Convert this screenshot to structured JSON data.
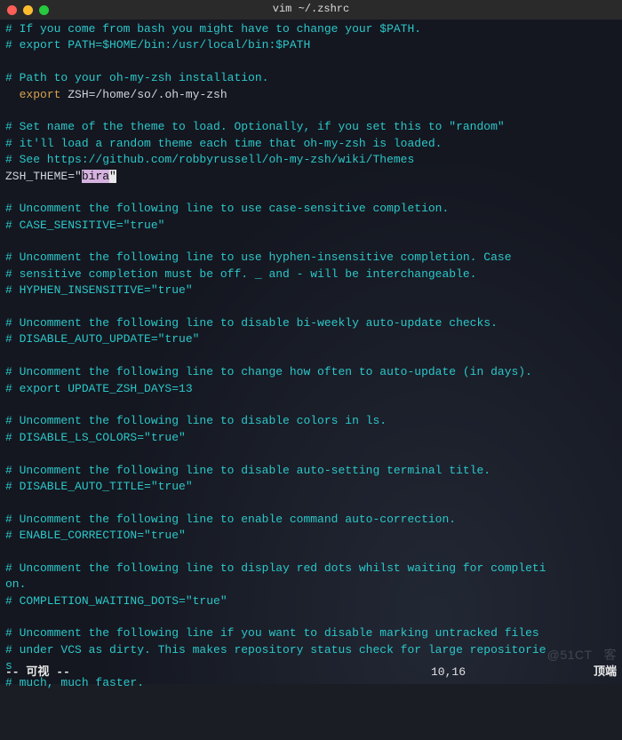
{
  "window": {
    "title": "vim ~/.zshrc"
  },
  "lines": [
    {
      "segments": [
        {
          "cls": "comment",
          "t": "# If you come from bash you might have to change your $PATH."
        }
      ]
    },
    {
      "segments": [
        {
          "cls": "comment",
          "t": "# export PATH=$HOME/bin:/usr/local/bin:$PATH"
        }
      ]
    },
    {
      "segments": []
    },
    {
      "segments": [
        {
          "cls": "comment",
          "t": "# Path to your oh-my-zsh installation."
        }
      ]
    },
    {
      "segments": [
        {
          "cls": "plain",
          "t": "  "
        },
        {
          "cls": "key",
          "t": "export"
        },
        {
          "cls": "plain",
          "t": " ZSH=/home/so/.oh-my-zsh"
        }
      ]
    },
    {
      "segments": []
    },
    {
      "segments": [
        {
          "cls": "comment",
          "t": "# Set name of the theme to load. Optionally, if you set this to \"random\""
        }
      ]
    },
    {
      "segments": [
        {
          "cls": "comment",
          "t": "# it'll load a random theme each time that oh-my-zsh is loaded."
        }
      ]
    },
    {
      "segments": [
        {
          "cls": "comment",
          "t": "# See https://github.com/robbyrussell/oh-my-zsh/wiki/Themes"
        }
      ]
    },
    {
      "segments": [
        {
          "cls": "plain",
          "t": "ZSH_THEME="
        },
        {
          "cls": "str",
          "t": "\""
        },
        {
          "cls": "hl-sel",
          "t": "bira"
        },
        {
          "cls": "hl-cur",
          "t": "\""
        }
      ]
    },
    {
      "segments": []
    },
    {
      "segments": [
        {
          "cls": "comment",
          "t": "# Uncomment the following line to use case-sensitive completion."
        }
      ]
    },
    {
      "segments": [
        {
          "cls": "comment",
          "t": "# CASE_SENSITIVE=\"true\""
        }
      ]
    },
    {
      "segments": []
    },
    {
      "segments": [
        {
          "cls": "comment",
          "t": "# Uncomment the following line to use hyphen-insensitive completion. Case"
        }
      ]
    },
    {
      "segments": [
        {
          "cls": "comment",
          "t": "# sensitive completion must be off. _ and - will be interchangeable."
        }
      ]
    },
    {
      "segments": [
        {
          "cls": "comment",
          "t": "# HYPHEN_INSENSITIVE=\"true\""
        }
      ]
    },
    {
      "segments": []
    },
    {
      "segments": [
        {
          "cls": "comment",
          "t": "# Uncomment the following line to disable bi-weekly auto-update checks."
        }
      ]
    },
    {
      "segments": [
        {
          "cls": "comment",
          "t": "# DISABLE_AUTO_UPDATE=\"true\""
        }
      ]
    },
    {
      "segments": []
    },
    {
      "segments": [
        {
          "cls": "comment",
          "t": "# Uncomment the following line to change how often to auto-update (in days)."
        }
      ]
    },
    {
      "segments": [
        {
          "cls": "comment",
          "t": "# export UPDATE_ZSH_DAYS=13"
        }
      ]
    },
    {
      "segments": []
    },
    {
      "segments": [
        {
          "cls": "comment",
          "t": "# Uncomment the following line to disable colors in ls."
        }
      ]
    },
    {
      "segments": [
        {
          "cls": "comment",
          "t": "# DISABLE_LS_COLORS=\"true\""
        }
      ]
    },
    {
      "segments": []
    },
    {
      "segments": [
        {
          "cls": "comment",
          "t": "# Uncomment the following line to disable auto-setting terminal title."
        }
      ]
    },
    {
      "segments": [
        {
          "cls": "comment",
          "t": "# DISABLE_AUTO_TITLE=\"true\""
        }
      ]
    },
    {
      "segments": []
    },
    {
      "segments": [
        {
          "cls": "comment",
          "t": "# Uncomment the following line to enable command auto-correction."
        }
      ]
    },
    {
      "segments": [
        {
          "cls": "comment",
          "t": "# ENABLE_CORRECTION=\"true\""
        }
      ]
    },
    {
      "segments": []
    },
    {
      "segments": [
        {
          "cls": "comment",
          "t": "# Uncomment the following line to display red dots whilst waiting for completi"
        }
      ]
    },
    {
      "segments": [
        {
          "cls": "comment",
          "t": "on."
        }
      ]
    },
    {
      "segments": [
        {
          "cls": "comment",
          "t": "# COMPLETION_WAITING_DOTS=\"true\""
        }
      ]
    },
    {
      "segments": []
    },
    {
      "segments": [
        {
          "cls": "comment",
          "t": "# Uncomment the following line if you want to disable marking untracked files"
        }
      ]
    },
    {
      "segments": [
        {
          "cls": "comment",
          "t": "# under VCS as dirty. This makes repository status check for large repositorie"
        }
      ]
    },
    {
      "segments": [
        {
          "cls": "comment",
          "t": "s"
        }
      ]
    },
    {
      "segments": [
        {
          "cls": "comment",
          "t": "# much, much faster."
        }
      ]
    }
  ],
  "status": {
    "mode": "-- 可视 --",
    "pos": "10,16",
    "scroll": "顶端"
  },
  "watermark": "@51CT   客"
}
